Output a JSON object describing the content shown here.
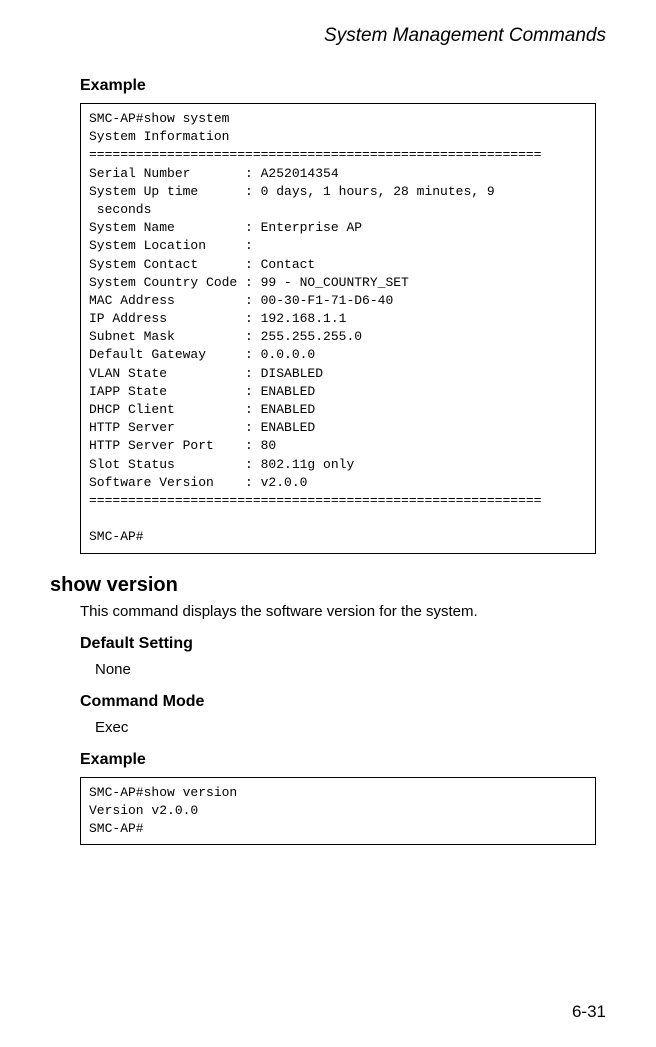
{
  "header": {
    "title": "System Management Commands"
  },
  "section1": {
    "heading": "Example",
    "codebox": "SMC-AP#show system\nSystem Information\n==========================================================\nSerial Number       : A252014354\nSystem Up time      : 0 days, 1 hours, 28 minutes, 9\n seconds\nSystem Name         : Enterprise AP\nSystem Location     :\nSystem Contact      : Contact\nSystem Country Code : 99 - NO_COUNTRY_SET \nMAC Address         : 00-30-F1-71-D6-40\nIP Address          : 192.168.1.1\nSubnet Mask         : 255.255.255.0\nDefault Gateway     : 0.0.0.0\nVLAN State          : DISABLED\nIAPP State          : ENABLED\nDHCP Client         : ENABLED\nHTTP Server         : ENABLED\nHTTP Server Port    : 80\nSlot Status         : 802.11g only\nSoftware Version    : v2.0.0\n==========================================================\n\nSMC-AP#"
  },
  "section2": {
    "cmd_heading": "show version",
    "description": "This command displays the software version for the system.",
    "default_setting_label": "Default Setting",
    "default_setting_value": "None",
    "command_mode_label": "Command Mode",
    "command_mode_value": "Exec",
    "example_label": "Example",
    "codebox": "SMC-AP#show version\nVersion v2.0.0\nSMC-AP#"
  },
  "footer": {
    "page_number": "6-31"
  }
}
